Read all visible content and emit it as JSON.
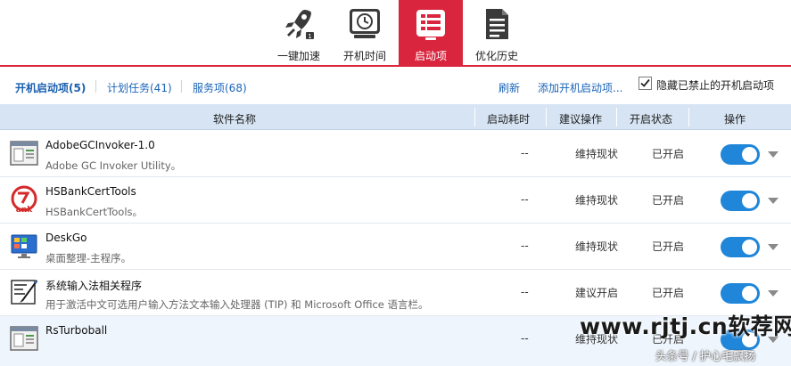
{
  "toolbar": {
    "items": [
      {
        "label": "一键加速",
        "icon": "rocket-icon"
      },
      {
        "label": "开机时间",
        "icon": "clock-icon"
      },
      {
        "label": "启动项",
        "icon": "startup-list-icon",
        "active": true
      },
      {
        "label": "优化历史",
        "icon": "history-document-icon"
      }
    ]
  },
  "tabs": {
    "startup": "开机启动项(5)",
    "tasks": "计划任务(41)",
    "services": "服务项(68)"
  },
  "actions": {
    "refresh": "刷新",
    "add": "添加开机启动项...",
    "hide_disabled": "隐藏已禁止的开机启动项",
    "hide_disabled_checked": true
  },
  "table": {
    "headers": {
      "name": "软件名称",
      "time": "启动耗时",
      "advice": "建议操作",
      "status": "开启状态",
      "action": "操作"
    },
    "rows": [
      {
        "name": "AdobeGCInvoker-1.0",
        "desc": "Adobe GC Invoker Utility。",
        "time": "--",
        "advice": "维持现状",
        "status": "已开启",
        "enabled": true,
        "icon": "app-window-icon"
      },
      {
        "name": "HSBankCertTools",
        "desc": "HSBankCertTools。",
        "time": "--",
        "advice": "维持现状",
        "status": "已开启",
        "enabled": true,
        "icon": "bank-logo-icon"
      },
      {
        "name": "DeskGo",
        "desc": "桌面整理-主程序。",
        "time": "--",
        "advice": "维持现状",
        "status": "已开启",
        "enabled": true,
        "icon": "monitor-icon"
      },
      {
        "name": "系统输入法相关程序",
        "desc": "用于激活中文可选用户输入方法文本输入处理器 (TIP) 和 Microsoft Office 语言栏。",
        "time": "--",
        "advice": "建议开启",
        "status": "已开启",
        "enabled": true,
        "icon": "pen-document-icon"
      },
      {
        "name": "RsTurboball",
        "desc": "",
        "time": "--",
        "advice": "维持现状",
        "status": "已开启",
        "enabled": true,
        "icon": "app-window-icon"
      }
    ]
  },
  "colors": {
    "accent": "#d9253d",
    "link": "#1a64b8",
    "toggle_on": "#1f86d9",
    "header_bg": "#d6e4f3"
  },
  "watermark": {
    "main": "www.rjtj.cn软荐网",
    "sub": "头条号 / 护心毛飘扬"
  }
}
